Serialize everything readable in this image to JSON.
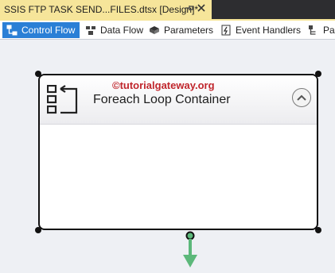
{
  "document_tab": {
    "title": "SSIS FTP TASK SEND...FILES.dtsx [Design]*",
    "pin_icon": "pin-icon",
    "close_label": "🗙"
  },
  "designer_tabs": [
    {
      "label": "Control Flow",
      "icon": "control-flow-icon",
      "active": true
    },
    {
      "label": "Data Flow",
      "icon": "data-flow-icon",
      "active": false
    },
    {
      "label": "Parameters",
      "icon": "parameters-icon",
      "active": false
    },
    {
      "label": "Event Handlers",
      "icon": "event-handlers-icon",
      "active": false
    },
    {
      "label": "Pac",
      "icon": "package-explorer-icon",
      "active": false
    }
  ],
  "container": {
    "title": "Foreach Loop Container",
    "icon": "foreach-loop-icon",
    "collapse_icon": "chevron-up-icon"
  },
  "watermark": "©tutorialgateway.org",
  "colors": {
    "tab_active": "#f6e59a",
    "toolbar_active": "#2a7fd6",
    "connector_arrow": "#5cb87a",
    "watermark": "#c0262c"
  }
}
